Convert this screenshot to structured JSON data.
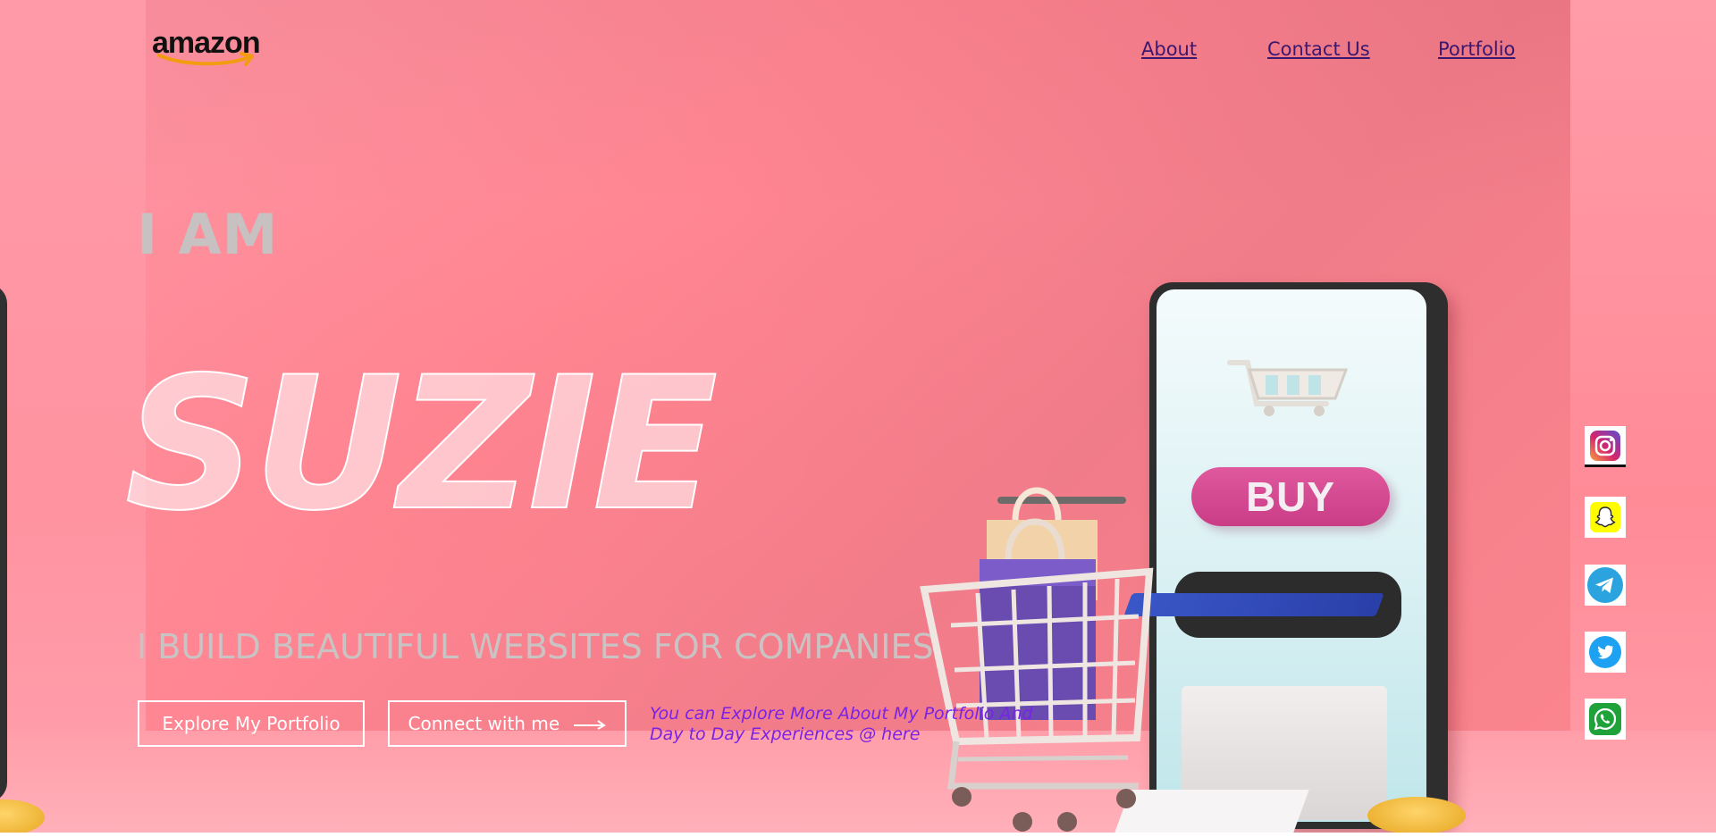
{
  "header": {
    "logo_text": "amazon",
    "nav": {
      "about": "About",
      "contact": "Contact Us",
      "portfolio": "Portfolio"
    }
  },
  "hero": {
    "intro": "I AM",
    "name": "SUZIE",
    "tagline": "I BUILD BEAUTIFUL WEBSITES FOR COMPANIES",
    "buy_label": "BUY",
    "buttons": {
      "explore": "Explore My Portfolio",
      "connect": "Connect with me"
    },
    "note": "You can Explore More About My Portfolio And Day to Day Experiences @ here"
  },
  "social": [
    {
      "icon": "instagram-icon"
    },
    {
      "icon": "snapchat-icon"
    },
    {
      "icon": "telegram-icon"
    },
    {
      "icon": "twitter-icon"
    },
    {
      "icon": "whatsapp-icon"
    }
  ],
  "colors": {
    "background": "#ff8793",
    "nav_link": "#3b1770",
    "note_text": "#7a22e6",
    "muted_text": "#c9c3c4",
    "button_border": "#ffffff"
  }
}
